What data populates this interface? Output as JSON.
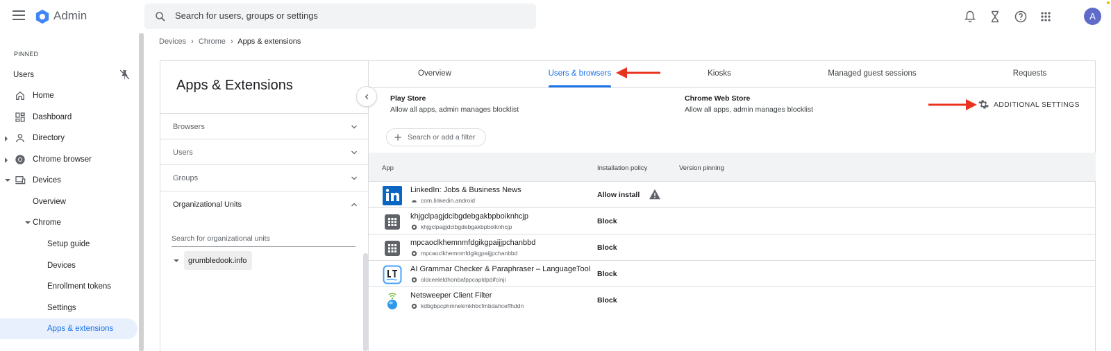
{
  "app": {
    "title": "Admin",
    "avatar_letter": "A"
  },
  "search": {
    "placeholder": "Search for users, groups or settings"
  },
  "nav": {
    "pinned_label": "PINNED",
    "users_pinned": "Users",
    "items": [
      {
        "label": "Home"
      },
      {
        "label": "Dashboard"
      },
      {
        "label": "Directory"
      },
      {
        "label": "Chrome browser"
      },
      {
        "label": "Devices"
      },
      {
        "label": "Overview"
      },
      {
        "label": "Chrome"
      },
      {
        "label": "Setup guide"
      },
      {
        "label": "Devices"
      },
      {
        "label": "Enrollment tokens"
      },
      {
        "label": "Settings"
      },
      {
        "label": "Apps & extensions"
      }
    ]
  },
  "breadcrumb": [
    "Devices",
    "Chrome",
    "Apps & extensions"
  ],
  "left_pane": {
    "title": "Apps & Extensions",
    "sections": [
      "Browsers",
      "Users",
      "Groups",
      "Organizational Units"
    ],
    "ou_search_placeholder": "Search for organizational units",
    "ou_root": "grumbledook.info"
  },
  "tabs": [
    "Overview",
    "Users & browsers",
    "Kiosks",
    "Managed guest sessions",
    "Requests"
  ],
  "stores": {
    "play": {
      "title": "Play Store",
      "desc": "Allow all apps, admin manages blocklist"
    },
    "web": {
      "title": "Chrome Web Store",
      "desc": "Allow all apps, admin manages blocklist"
    }
  },
  "additional_settings": "ADDITIONAL SETTINGS",
  "filter": {
    "placeholder": "Search or add a filter"
  },
  "table": {
    "headers": [
      "App",
      "Installation policy",
      "Version pinning"
    ],
    "rows": [
      {
        "name": "LinkedIn: Jobs & Business News",
        "id": "com.linkedin.android",
        "policy": "Allow install",
        "icon": "linkedin-icon"
      },
      {
        "name": "khjgclpagjdcibgdebgakbpboiknhcjp",
        "id": "khjgclpagjdcibgdebgakbpboiknhcjp",
        "policy": "Block",
        "icon": "grid-app-icon"
      },
      {
        "name": "mpcaoclkhemnmfdgikgpaijjpchanbbd",
        "id": "mpcaoclkhemnmfdgikgpaijjpchanbbd",
        "policy": "Block",
        "icon": "grid-app-icon"
      },
      {
        "name": "AI Grammar Checker & Paraphraser – LanguageTool",
        "id": "oldceeleldhonbafppcapldpdifcinji",
        "policy": "Block",
        "icon": "languagetool-icon"
      },
      {
        "name": "Netsweeper Client Filter",
        "id": "kdbgbpcphmnekmkhbcfmbdahceffhddn",
        "policy": "Block",
        "icon": "netsweeper-icon"
      }
    ]
  },
  "colors": {
    "accent": "#1a73e8",
    "active_bg": "#e8f0fe",
    "annotation_arrow": "#e8331f"
  }
}
